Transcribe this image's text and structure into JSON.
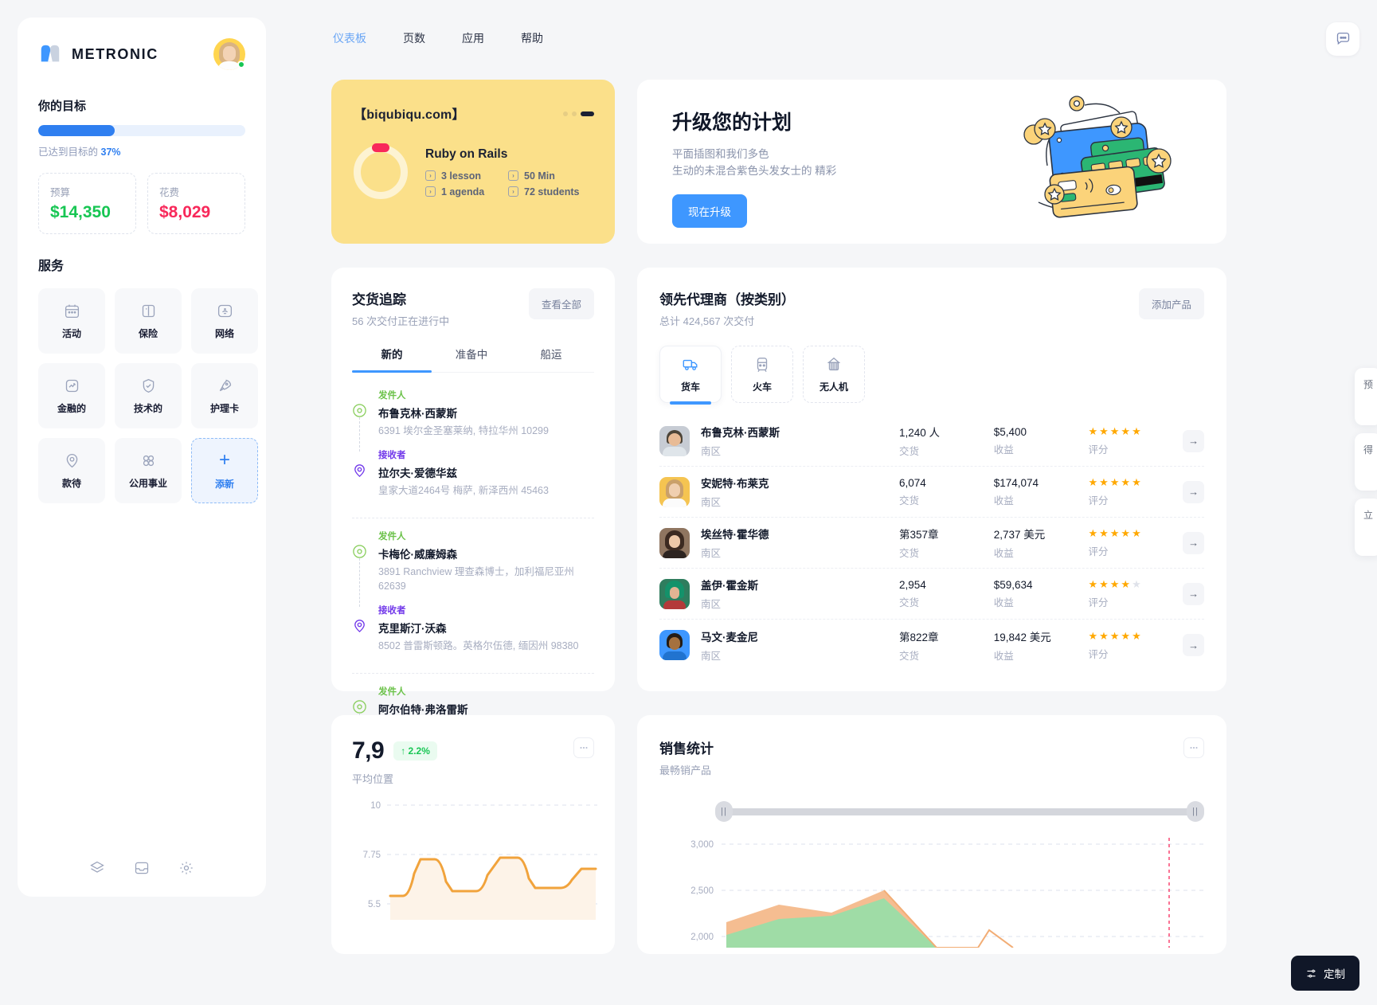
{
  "sidebar": {
    "brand_name": "METRONIC",
    "goal_title": "你的目标",
    "progress_percent": 37,
    "progress_note_prefix": "已达到目标的",
    "progress_note_value": "37%",
    "stats": [
      {
        "label": "预算",
        "value": "$14,350",
        "color": "#17c653"
      },
      {
        "label": "花费",
        "value": "$8,029",
        "color": "#f8285a"
      }
    ],
    "services_title": "服务",
    "services": [
      {
        "label": "活动",
        "icon": "calendar-icon"
      },
      {
        "label": "保险",
        "icon": "book-icon"
      },
      {
        "label": "网络",
        "icon": "wifi-icon"
      },
      {
        "label": "金融的",
        "icon": "chart-up-icon"
      },
      {
        "label": "技术的",
        "icon": "shield-check-icon"
      },
      {
        "label": "护理卡",
        "icon": "rocket-icon"
      },
      {
        "label": "款待",
        "icon": "map-pin-icon"
      },
      {
        "label": "公用事业",
        "icon": "grid-dots-icon"
      },
      {
        "label": "添新",
        "icon": "plus-icon"
      }
    ],
    "footer_icons": [
      "layers-icon",
      "inbox-icon",
      "gear-icon"
    ]
  },
  "topnav": {
    "items": [
      {
        "label": "仪表板",
        "active": true
      },
      {
        "label": "页数",
        "active": false
      },
      {
        "label": "应用",
        "active": false
      },
      {
        "label": "帮助",
        "active": false
      }
    ],
    "chat_icon": "chat-bubble-icon"
  },
  "course_card": {
    "domain": "【biqubiqu.com】",
    "course_name": "Ruby on Rails",
    "meta": [
      "3 lesson",
      "50 Min",
      "1 agenda",
      "72 students"
    ]
  },
  "upgrade_card": {
    "title": "升级您的计划",
    "desc_line1": "平面插图和我们多色",
    "desc_line2": "生动的未混合紫色头发女士的 精彩",
    "button": "现在升级"
  },
  "delivery_card": {
    "title": "交货追踪",
    "subtitle": "56 次交付正在进行中",
    "view_all": "查看全部",
    "tabs": [
      {
        "label": "新的",
        "active": true
      },
      {
        "label": "准备中",
        "active": false
      },
      {
        "label": "船运",
        "active": false
      }
    ],
    "label_sender": "发件人",
    "label_receiver": "接收者",
    "entries": [
      {
        "sender_name": "布鲁克林·西蒙斯",
        "sender_addr": "6391 埃尔金圣塞莱纳, 特拉华州 10299",
        "receiver_name": "拉尔夫·爱德华兹",
        "receiver_addr": "皇家大道2464号 梅萨, 新泽西州 45463"
      },
      {
        "sender_name": "卡梅伦·威廉姆森",
        "sender_addr": "3891 Ranchview 理查森博士，加利福尼亚州 62639",
        "receiver_name": "克里斯汀·沃森",
        "receiver_addr": "8502 普雷斯顿路。英格尔伍德, 缅因州 98380"
      },
      {
        "sender_name": "阿尔伯特·弗洛雷斯",
        "sender_addr": "",
        "receiver_name": "",
        "receiver_addr": ""
      }
    ]
  },
  "agents_card": {
    "title": "领先代理商（按类别）",
    "subtitle": "总计 424,567 次交付",
    "add_button": "添加产品",
    "categories": [
      {
        "label": "货车",
        "icon": "truck-icon",
        "active": true
      },
      {
        "label": "火车",
        "icon": "train-icon",
        "active": false
      },
      {
        "label": "无人机",
        "icon": "drone-icon",
        "active": false
      }
    ],
    "col_caption_delivery": "交货",
    "col_caption_revenue": "收益",
    "col_caption_rating": "评分",
    "rows": [
      {
        "name": "布鲁克林·西蒙斯",
        "region": "南区",
        "delivery": "1,240 人",
        "revenue": "$5,400",
        "stars": 5,
        "avatar_color": "#c7ccd4"
      },
      {
        "name": "安妮特·布莱克",
        "region": "南区",
        "delivery": "6,074",
        "revenue": "$174,074",
        "stars": 5,
        "avatar_color": "#f5c451"
      },
      {
        "name": "埃丝特·霍华德",
        "region": "南区",
        "delivery": "第357章",
        "revenue": "2,737 美元",
        "stars": 5,
        "avatar_color": "#8f7560"
      },
      {
        "name": "盖伊·霍金斯",
        "region": "南区",
        "delivery": "2,954",
        "revenue": "$59,634",
        "stars": 4,
        "avatar_color": "#2f7d5e"
      },
      {
        "name": "马文·麦金尼",
        "region": "南区",
        "delivery": "第822章",
        "revenue": "19,842 美元",
        "stars": 5,
        "avatar_color": "#3e97ff"
      }
    ]
  },
  "avg_card": {
    "value": "7,9",
    "delta": "↑ 2.2%",
    "label": "平均位置",
    "menu_icon": "ellipsis-icon"
  },
  "sales_card": {
    "title": "销售统计",
    "subtitle": "最畅销产品",
    "menu_icon": "ellipsis-icon"
  },
  "edge_drawer": {
    "items": [
      "预",
      "",
      "得",
      "立"
    ]
  },
  "customize_fab": {
    "label": "定制",
    "icon": "sliders-icon"
  },
  "chart_data": [
    {
      "id": "avg-position-chart",
      "type": "area",
      "title": "平均位置",
      "xlabel": "",
      "ylabel": "",
      "ylim": [
        5.5,
        10
      ],
      "yticks": [
        10,
        7.75,
        5.5
      ],
      "ytick_labels": [
        "10",
        "7.75",
        "5.5"
      ],
      "grid": true,
      "line_color": "#f1a33c",
      "fill_color": "#fdf2e4",
      "x": [
        0,
        1,
        2,
        3,
        4,
        5,
        6,
        7,
        8,
        9,
        10
      ],
      "values": [
        5.9,
        5.9,
        7.6,
        7.6,
        6.3,
        6.3,
        5.9,
        7.8,
        7.8,
        6.6,
        6.6
      ]
    },
    {
      "id": "sales-statistics-chart",
      "type": "area",
      "title": "销售统计",
      "subtitle": "最畅销产品",
      "xlabel": "",
      "ylabel": "",
      "ylim": [
        1500,
        3000
      ],
      "yticks": [
        3000,
        2500,
        2000
      ],
      "ytick_labels": [
        "3,000",
        "2,500",
        "2,000"
      ],
      "grid": true,
      "legend": "none",
      "series": [
        {
          "name": "series-orange",
          "color": "#f0a868",
          "values": [
            2150,
            2380,
            2280,
            2520,
            1700,
            1640,
            1900,
            1580,
            1720,
            2050
          ]
        },
        {
          "name": "series-green",
          "color": "#9fdca6",
          "values": [
            1880,
            2080,
            2120,
            2440,
            1560,
            1480,
            1500,
            1460,
            1600,
            1880
          ]
        }
      ],
      "x": [
        0,
        1,
        2,
        3,
        4,
        5,
        6,
        7,
        8,
        9
      ],
      "marker_line_x": 7,
      "marker_line_color": "#f8285a"
    }
  ]
}
